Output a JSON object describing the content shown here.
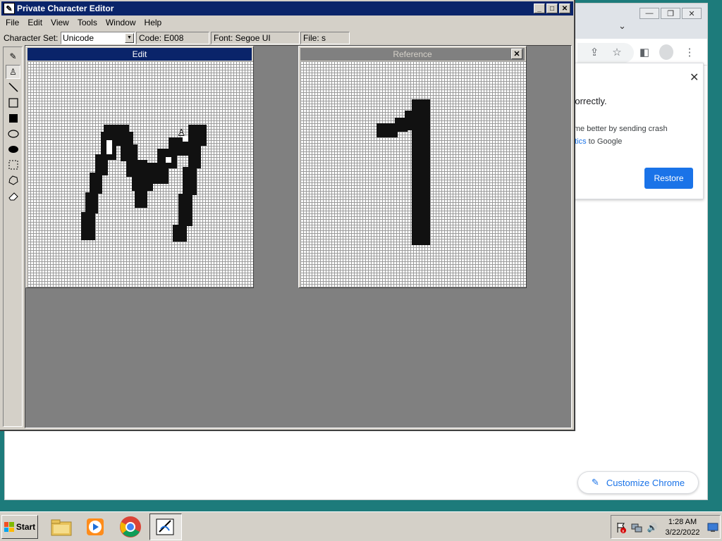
{
  "pce": {
    "title": "Private Character Editor",
    "menus": [
      "File",
      "Edit",
      "View",
      "Tools",
      "Window",
      "Help"
    ],
    "charset_label": "Character Set:",
    "charset_value": "Unicode",
    "code": "Code: E008",
    "font": "Font: Segoe UI",
    "file": "File: s",
    "edit_title": "Edit",
    "reference_title": "Reference",
    "tools": [
      "pencil-icon",
      "brush-icon",
      "line-icon",
      "hollow-rectangle-icon",
      "filled-rectangle-icon",
      "hollow-ellipse-icon",
      "filled-ellipse-icon",
      "rectangular-selection-icon",
      "freeform-selection-icon",
      "eraser-icon"
    ],
    "active_tool": "brush-icon"
  },
  "chrome": {
    "bubble_title": "n correctly.",
    "bubble_line1": "hrome better by sending crash",
    "bubble_line2_link": "atistics",
    "bubble_line2_rest": " to Google",
    "restore": "Restore",
    "customize": "Customize Chrome"
  },
  "taskbar": {
    "start": "Start",
    "time": "1:28 AM",
    "date": "3/22/2022"
  }
}
